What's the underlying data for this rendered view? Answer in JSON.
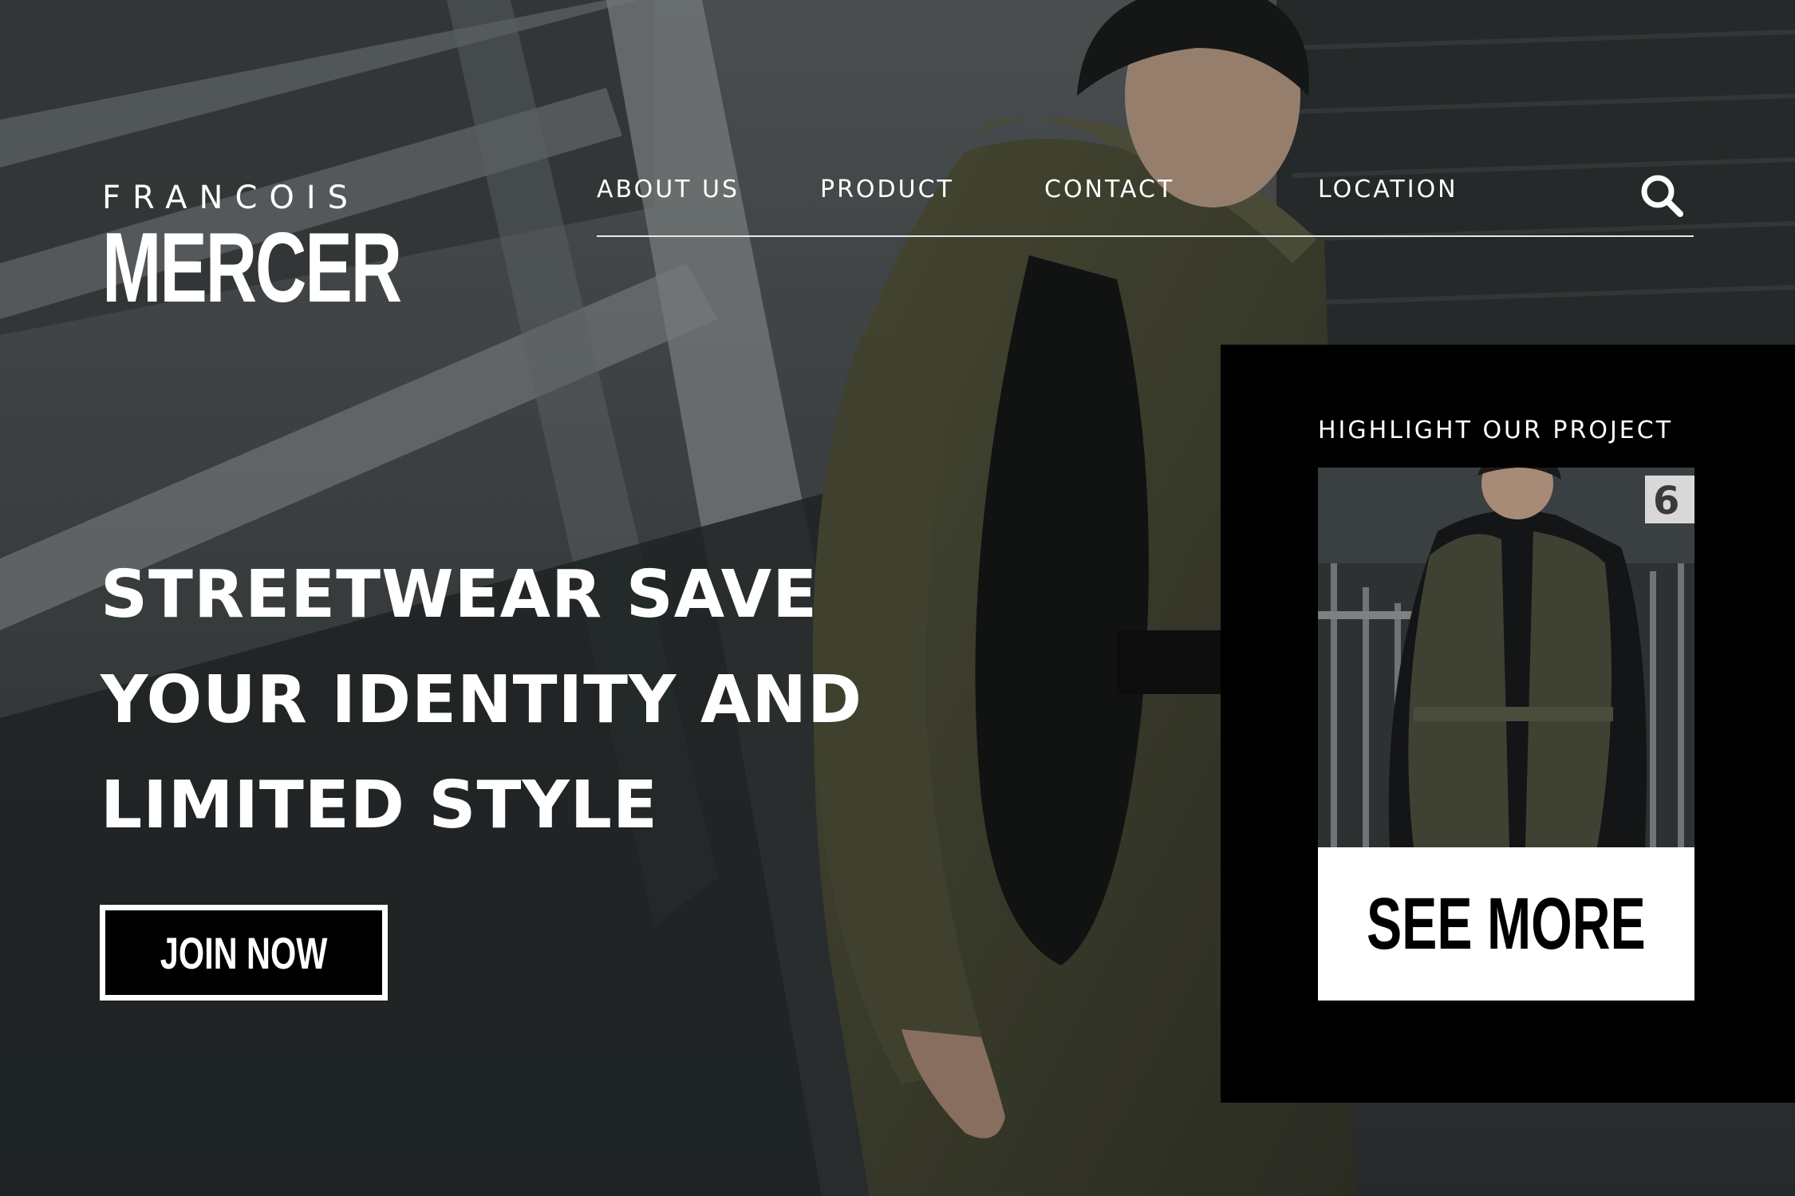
{
  "brand": {
    "top": "FRANCOIS",
    "bottom": "MERCER"
  },
  "nav": {
    "items": [
      {
        "label": "ABOUT US"
      },
      {
        "label": "PRODUCT"
      },
      {
        "label": "CONTACT"
      },
      {
        "label": "LOCATION"
      }
    ],
    "search_icon": "search-icon"
  },
  "hero": {
    "headline_lines": [
      "STREETWEAR SAVE",
      "YOUR IDENTITY AND",
      "LIMITED STYLE"
    ],
    "cta_label": "JOIN NOW"
  },
  "highlight": {
    "title": "HIGHLIGHT OUR PROJECT",
    "button_label": "SEE MORE"
  },
  "colors": {
    "card_bg": "#000000",
    "text": "#ffffff",
    "jacket_olive": "#4b4d36"
  }
}
